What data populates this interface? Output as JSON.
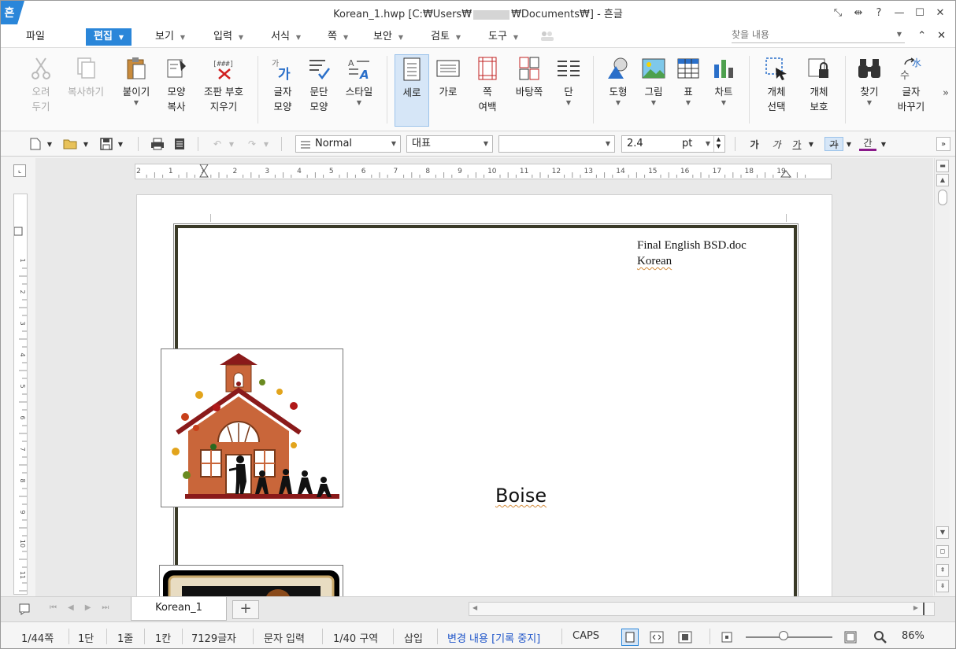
{
  "window": {
    "logo": "흔",
    "title_pre": "Korean_1.hwp [C:₩Users₩",
    "title_post": "₩Documents₩] - 흔글",
    "controls": [
      "⤡",
      "⇹",
      "?",
      "—",
      "☐",
      "✕"
    ]
  },
  "menu": {
    "file": "파일",
    "items": [
      "편집",
      "보기",
      "입력",
      "서식",
      "쪽",
      "보안",
      "검토",
      "도구"
    ],
    "search_placeholder": "찾을 내용",
    "right_controls": [
      "⌃",
      "✕"
    ]
  },
  "ribbon": {
    "cut": "오려\n두기",
    "copy": "복사하기",
    "paste": "붙이기",
    "format_copy": "모양\n복사",
    "clear_marks": "조판 부호\n지우기",
    "char_shape": "글자\n모양",
    "para_shape": "문단\n모양",
    "style": "스타일",
    "portrait": "세로",
    "landscape": "가로",
    "page_margin": "쪽\n여백",
    "background": "바탕쪽",
    "columns": "단",
    "shape": "도형",
    "picture": "그림",
    "table": "표",
    "chart": "차트",
    "select_object": "개체\n선택",
    "protect_object": "개체\n보호",
    "find": "찾기",
    "replace": "글자\n바꾸기"
  },
  "format_bar": {
    "style_value": "Normal",
    "font_lang_value": "대표",
    "font_value": "",
    "size_value": "2.4",
    "size_unit": "pt",
    "bold_glyph": "가",
    "italic_glyph": "가",
    "underline_glyph": "가",
    "strike_glyph": "가",
    "color_glyph": "간"
  },
  "ruler": {
    "top_ticks": [
      "2",
      "1",
      "1",
      "2",
      "3",
      "4",
      "5",
      "6",
      "7",
      "8",
      "9",
      "10",
      "11",
      "12",
      "13",
      "14",
      "15",
      "16",
      "17",
      "18",
      "19"
    ],
    "left_ticks": [
      "1",
      "2",
      "3",
      "4",
      "5",
      "6",
      "7",
      "8",
      "9",
      "10",
      "11"
    ]
  },
  "document": {
    "header_line1": "Final  English  BSD.doc",
    "header_line2": "Korean",
    "body_word": "Boise"
  },
  "tabs": {
    "doc_tab": "Korean_1",
    "add": "+"
  },
  "status": {
    "page": "1/44쪽",
    "column": "1단",
    "line": "1줄",
    "col_pos": "1칸",
    "chars": "7129글자",
    "mode": "문자 입력",
    "section": "1/40 구역",
    "insert": "삽입",
    "track": "변경 내용 [기록 중지]",
    "caps": "CAPS",
    "zoom": "86%"
  },
  "colors": {
    "accent": "#2a86d9",
    "frame": "#3a3a28",
    "track_text": "#1f55c9"
  }
}
